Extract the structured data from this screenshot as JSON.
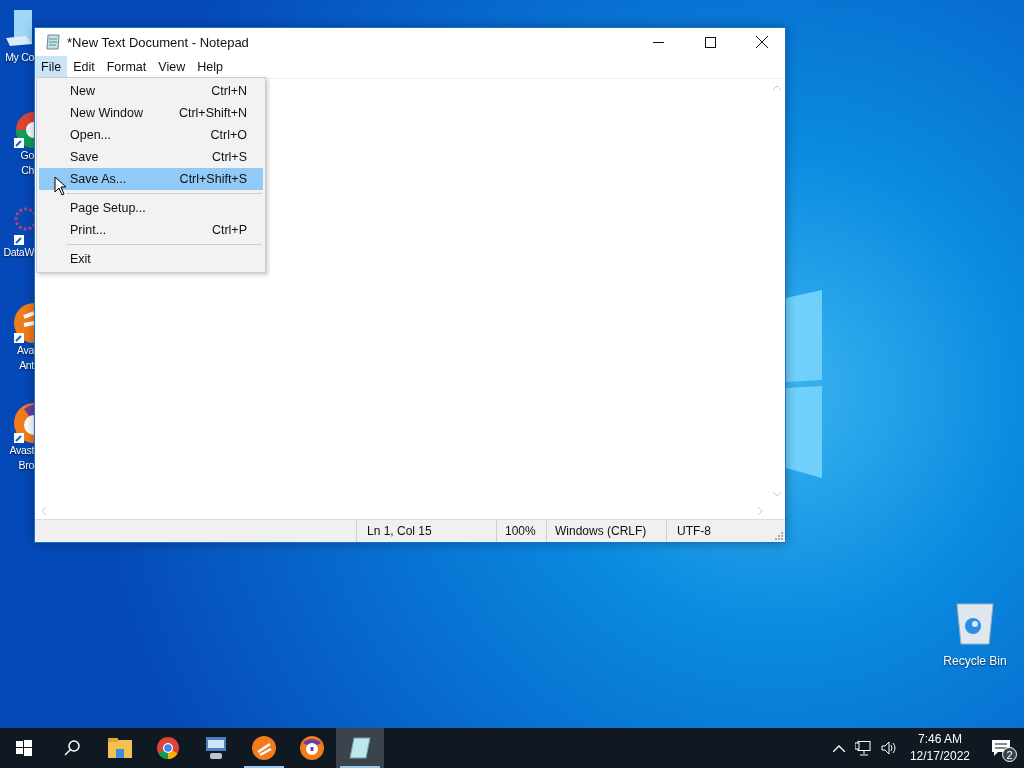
{
  "desktop_icons": [
    {
      "kind": "computer",
      "lines": [
        "My Co"
      ]
    },
    {
      "kind": "chrome",
      "lines": [
        "Go",
        "Ch"
      ]
    },
    {
      "kind": "dataviz",
      "lines": [
        "DataW"
      ]
    },
    {
      "kind": "avast",
      "lines": [
        "Ava",
        "Ant"
      ]
    },
    {
      "kind": "avast-browser",
      "lines": [
        "Avast",
        "Bro"
      ]
    }
  ],
  "window": {
    "title": "*New Text Document - Notepad",
    "menu": [
      {
        "label": "File",
        "selected": true
      },
      {
        "label": "Edit",
        "selected": false
      },
      {
        "label": "Format",
        "selected": false
      },
      {
        "label": "View",
        "selected": false
      },
      {
        "label": "Help",
        "selected": false
      }
    ],
    "file_menu": [
      {
        "kind": "item",
        "label": "New",
        "shortcut": "Ctrl+N",
        "selected": false
      },
      {
        "kind": "item",
        "label": "New Window",
        "shortcut": "Ctrl+Shift+N",
        "selected": false
      },
      {
        "kind": "item",
        "label": "Open...",
        "shortcut": "Ctrl+O",
        "selected": false
      },
      {
        "kind": "item",
        "label": "Save",
        "shortcut": "Ctrl+S",
        "selected": false
      },
      {
        "kind": "item",
        "label": "Save As...",
        "shortcut": "Ctrl+Shift+S",
        "selected": true
      },
      {
        "kind": "separator"
      },
      {
        "kind": "item",
        "label": "Page Setup...",
        "selected": false
      },
      {
        "kind": "item",
        "label": "Print...",
        "shortcut": "Ctrl+P",
        "selected": false
      },
      {
        "kind": "separator"
      },
      {
        "kind": "item",
        "label": "Exit",
        "selected": false
      }
    ],
    "status_bar": [
      "Ln 1, Col 15",
      "100%",
      "Windows (CRLF)",
      "UTF-8"
    ]
  },
  "recycle_bin": {
    "label": "Recycle Bin"
  },
  "taskbar": {
    "apps": [
      {
        "kind": "explorer",
        "running": false,
        "active": false
      },
      {
        "kind": "chrome",
        "running": false,
        "active": false
      },
      {
        "kind": "network",
        "running": false,
        "active": false
      },
      {
        "kind": "avast",
        "running": true,
        "active": false
      },
      {
        "kind": "avast-browser",
        "running": false,
        "active": false
      },
      {
        "kind": "notepad",
        "running": true,
        "active": true
      }
    ],
    "time": "7:46 AM",
    "date": "12/17/2022",
    "notifications": "2"
  }
}
